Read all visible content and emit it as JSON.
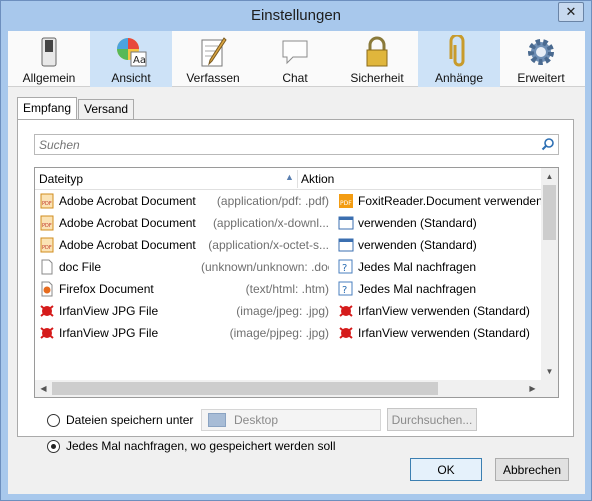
{
  "window": {
    "title": "Einstellungen",
    "close_glyph": "✕"
  },
  "toolbar": {
    "items": [
      {
        "label": "Allgemein",
        "icon": "switch-icon",
        "active": false
      },
      {
        "label": "Ansicht",
        "icon": "color-wheel-icon",
        "active": true
      },
      {
        "label": "Verfassen",
        "icon": "compose-icon",
        "active": false
      },
      {
        "label": "Chat",
        "icon": "chat-bubble-icon",
        "active": false
      },
      {
        "label": "Sicherheit",
        "icon": "lock-icon",
        "active": false
      },
      {
        "label": "Anhänge",
        "icon": "paperclip-icon",
        "active": true
      },
      {
        "label": "Erweitert",
        "icon": "gear-icon",
        "active": false
      }
    ]
  },
  "tabs": [
    {
      "label": "Empfang",
      "active": true
    },
    {
      "label": "Versand",
      "active": false
    }
  ],
  "search": {
    "placeholder": "Suchen",
    "value": ""
  },
  "table": {
    "headers": {
      "type": "Dateityp",
      "action": "Aktion"
    },
    "sort_indicator": "▲",
    "rows": [
      {
        "icon": "pdf-icon",
        "name": "Adobe Acrobat Document",
        "mime": "(application/pdf: .pdf)",
        "action_icon": "foxit-pdf-icon",
        "action": "FoxitReader.Document verwenden"
      },
      {
        "icon": "pdf-icon",
        "name": "Adobe Acrobat Document",
        "mime": "(application/x-downl...",
        "action_icon": "app-window-icon",
        "action": "verwenden (Standard)"
      },
      {
        "icon": "pdf-icon",
        "name": "Adobe Acrobat Document",
        "mime": "(application/x-octet-s...",
        "action_icon": "app-window-icon",
        "action": "verwenden (Standard)"
      },
      {
        "icon": "blank-file-icon",
        "name": "doc  File",
        "mime": "(unknown/unknown: .doc )",
        "action_icon": "question-icon",
        "action": "Jedes Mal nachfragen"
      },
      {
        "icon": "firefox-doc-icon",
        "name": "Firefox Document",
        "mime": "(text/html: .htm)",
        "action_icon": "question-icon",
        "action": "Jedes Mal nachfragen"
      },
      {
        "icon": "irfanview-icon",
        "name": "IrfanView JPG File",
        "mime": "(image/jpeg: .jpg)",
        "action_icon": "irfanview-icon",
        "action": "IrfanView verwenden (Standard)"
      },
      {
        "icon": "irfanview-icon",
        "name": "IrfanView JPG File",
        "mime": "(image/pjpeg: .jpg)",
        "action_icon": "irfanview-icon",
        "action": "IrfanView verwenden (Standard)"
      }
    ]
  },
  "downloads": {
    "save_to_label": "Dateien speichern unter",
    "save_to_selected": false,
    "folder": "Desktop",
    "browse_label": "Durchsuchen...",
    "ask_label": "Jedes Mal nachfragen, wo gespeichert werden soll",
    "ask_selected": true
  },
  "buttons": {
    "ok": "OK",
    "cancel": "Abbrechen"
  },
  "colors": {
    "accent": "#cde2f7",
    "titlebar": "#a8c8ec"
  }
}
